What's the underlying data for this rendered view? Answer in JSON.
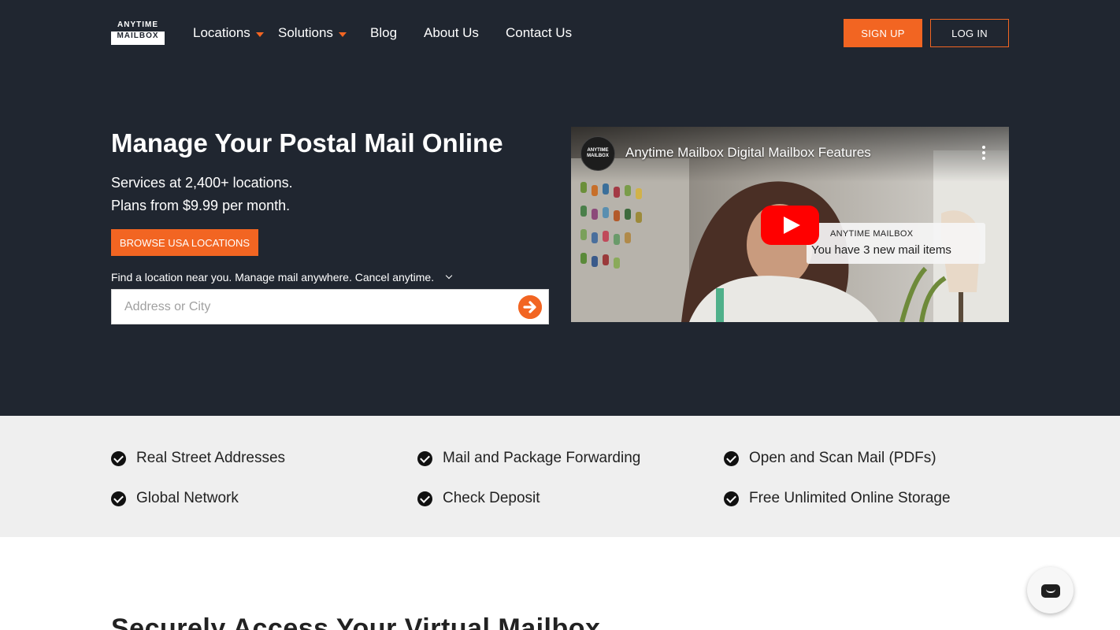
{
  "brand": {
    "logo_top": "ANYTIME",
    "logo_bottom": "MAILBOX"
  },
  "nav": {
    "items": [
      {
        "label": "Locations",
        "has_dropdown": true
      },
      {
        "label": "Solutions",
        "has_dropdown": true
      },
      {
        "label": "Blog",
        "has_dropdown": false
      },
      {
        "label": "About Us",
        "has_dropdown": false
      },
      {
        "label": "Contact Us",
        "has_dropdown": false
      }
    ],
    "signup_label": "SIGN UP",
    "login_label": "LOG IN"
  },
  "hero": {
    "title": "Manage Your Postal Mail Online",
    "subtitle_line1": "Services at 2,400+ locations.",
    "subtitle_line2": "Plans from $9.99 per month.",
    "browse_label": "BROWSE USA LOCATIONS",
    "find_text": "Find a location near you. Manage mail anywhere. Cancel anytime.",
    "search_placeholder": "Address or City",
    "search_value": ""
  },
  "video": {
    "title": "Anytime Mailbox Digital Mailbox Features",
    "channel_avatar_text": "ANYTIME MAILBOX",
    "notification_brand": "ANYTIME MAILBOX",
    "notification_message": "You have 3 new mail items"
  },
  "features": {
    "items": [
      "Real Street Addresses",
      "Mail and Package Forwarding",
      "Open and Scan Mail (PDFs)",
      "Global Network",
      "Check Deposit",
      "Free Unlimited Online Storage"
    ]
  },
  "section": {
    "heading": "Securely Access Your Virtual Mailbox"
  },
  "colors": {
    "accent": "#f26522",
    "hero_bg": "#202630",
    "features_bg": "#efefef"
  },
  "icons": {
    "play": "play-icon",
    "chat": "chat-icon",
    "check": "check-circle-icon",
    "go": "arrow-right-circle-icon",
    "more": "more-vertical-icon"
  }
}
